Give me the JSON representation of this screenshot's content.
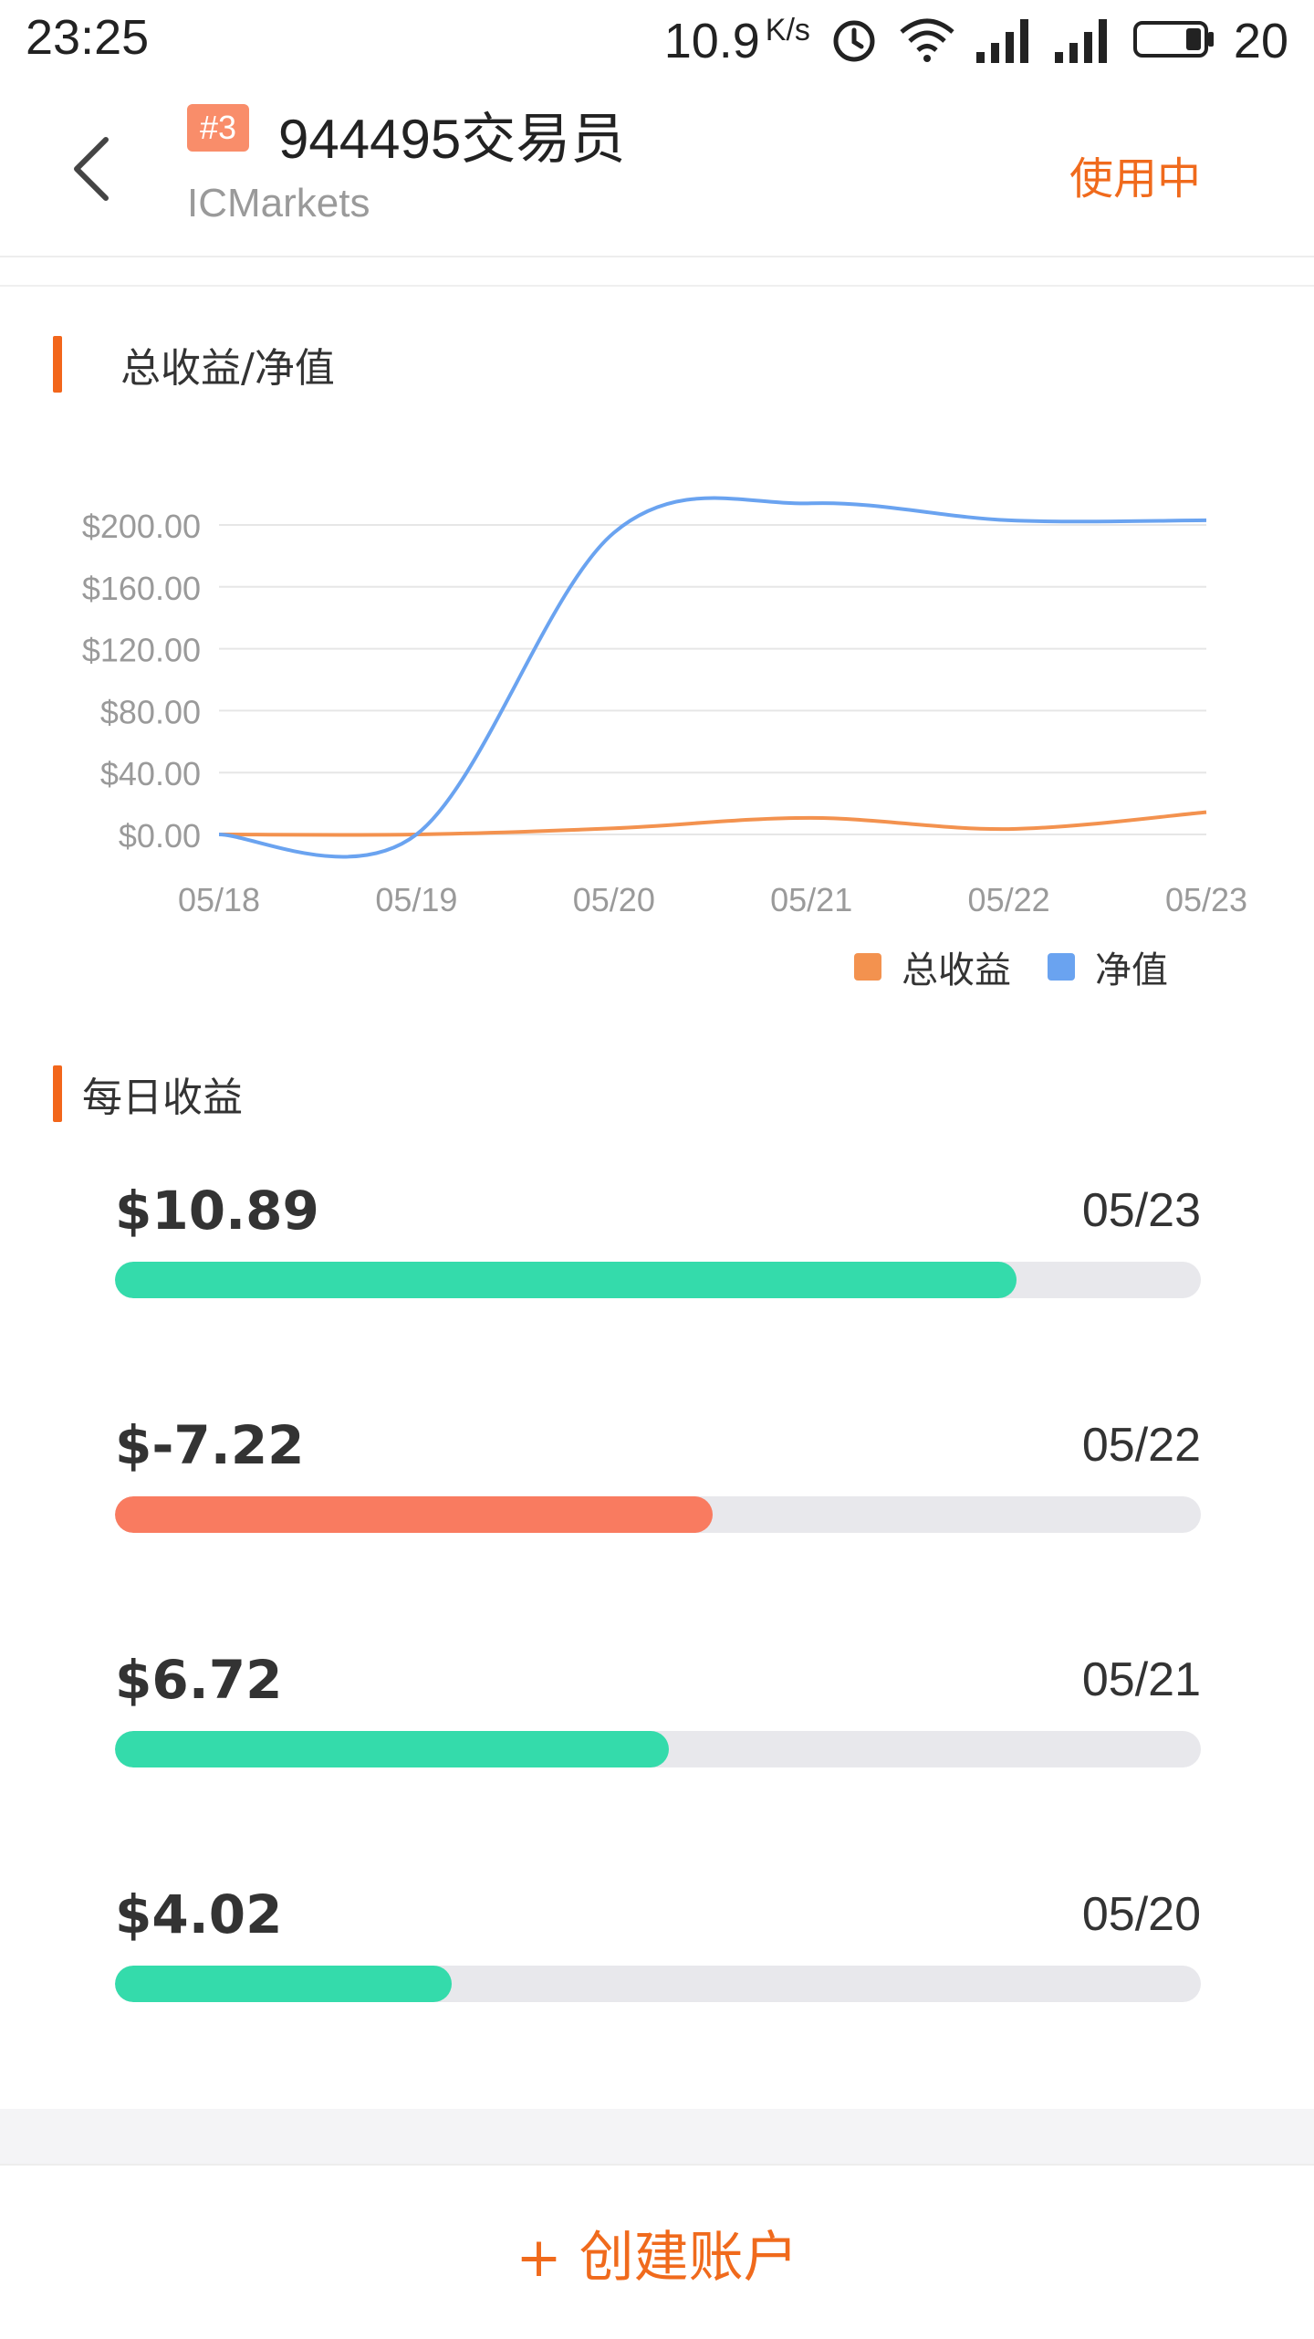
{
  "status_bar": {
    "time": "23:25",
    "network_speed": "10.9",
    "network_speed_unit": "K/s",
    "battery_percent": "20",
    "icons": [
      "alarm-icon",
      "wifi-icon",
      "signal-icon",
      "signal-icon",
      "battery-icon"
    ]
  },
  "header": {
    "rank": "#3",
    "title": "944495交易员",
    "broker": "ICMarkets",
    "status": "使用中",
    "back_icon": "chevron-left-icon"
  },
  "colors": {
    "accent": "#f06a1c",
    "badge": "#f98d6a",
    "profit_series": "#f3924f",
    "equity_series": "#6aa3f0",
    "positive": "#34dbab",
    "negative": "#f97b60",
    "track": "#e8e8ec"
  },
  "sections": {
    "chart_title": "总收益/净值",
    "daily_title": "每日收益"
  },
  "chart_data": {
    "type": "line",
    "x": [
      "05/18",
      "05/19",
      "05/20",
      "05/21",
      "05/22",
      "05/23"
    ],
    "y_ticks": [
      "$0.00",
      "$40.00",
      "$80.00",
      "$120.00",
      "$160.00",
      "$200.00"
    ],
    "ylim": [
      -20,
      240
    ],
    "grid": true,
    "legend_position": "bottom-right",
    "series": [
      {
        "name": "总收益",
        "color": "#f3924f",
        "values": [
          0,
          0,
          4,
          10.7,
          3.5,
          14.4
        ]
      },
      {
        "name": "净值",
        "color": "#6aa3f0",
        "values": [
          0,
          0,
          195,
          214,
          203,
          203
        ]
      }
    ]
  },
  "daily": [
    {
      "amount": "$10.89",
      "date": "05/23",
      "fill_fraction": 0.83,
      "sign": "positive"
    },
    {
      "amount": "$-7.22",
      "date": "05/22",
      "fill_fraction": 0.55,
      "sign": "negative"
    },
    {
      "amount": "$6.72",
      "date": "05/21",
      "fill_fraction": 0.51,
      "sign": "positive"
    },
    {
      "amount": "$4.02",
      "date": "05/20",
      "fill_fraction": 0.31,
      "sign": "positive"
    }
  ],
  "footer": {
    "create_label": "+ 创建账户"
  }
}
